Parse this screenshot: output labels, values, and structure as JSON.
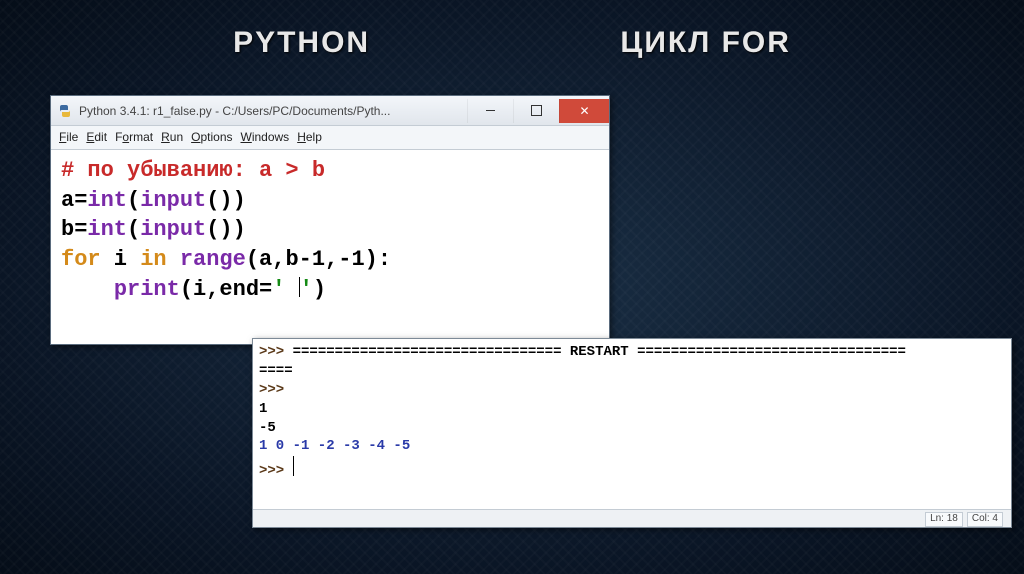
{
  "slide": {
    "title_left": "PYTHON",
    "title_right": "ЦИКЛ FOR"
  },
  "editor": {
    "window_title": "Python 3.4.1: r1_false.py - C:/Users/PC/Documents/Pyth...",
    "menus": {
      "file": "File",
      "edit": "Edit",
      "format": "Format",
      "run": "Run",
      "options": "Options",
      "windows": "Windows",
      "help": "Help"
    },
    "code": {
      "comment": "# по убыванию: a > b",
      "line2_a": "a=",
      "line2_fn": "int",
      "line2_b": "(",
      "line2_fn2": "input",
      "line2_c": "())",
      "line3_a": "b=",
      "line3_fn": "int",
      "line3_b": "(",
      "line3_fn2": "input",
      "line3_c": "())",
      "line4_kw": "for",
      "line4_a": " i ",
      "line4_kw2": "in",
      "line4_b": " ",
      "line4_fn": "range",
      "line4_c": "(a,b-1,-1):",
      "line5_indent": "    ",
      "line5_fn": "print",
      "line5_a": "(i,end=",
      "line5_str": "' ",
      "line5_b": "'",
      "line5_c": ")"
    }
  },
  "shell": {
    "prompt": ">>>",
    "restart_prefix": "================================ ",
    "restart_label": "RESTART",
    "restart_suffix": " ================================",
    "restart_wrap": "====",
    "input1": "1",
    "input2": "-5",
    "output": "1 0 -1 -2 -3 -4 -5 ",
    "status_ln": "Ln: 18",
    "status_col": "Col: 4"
  }
}
